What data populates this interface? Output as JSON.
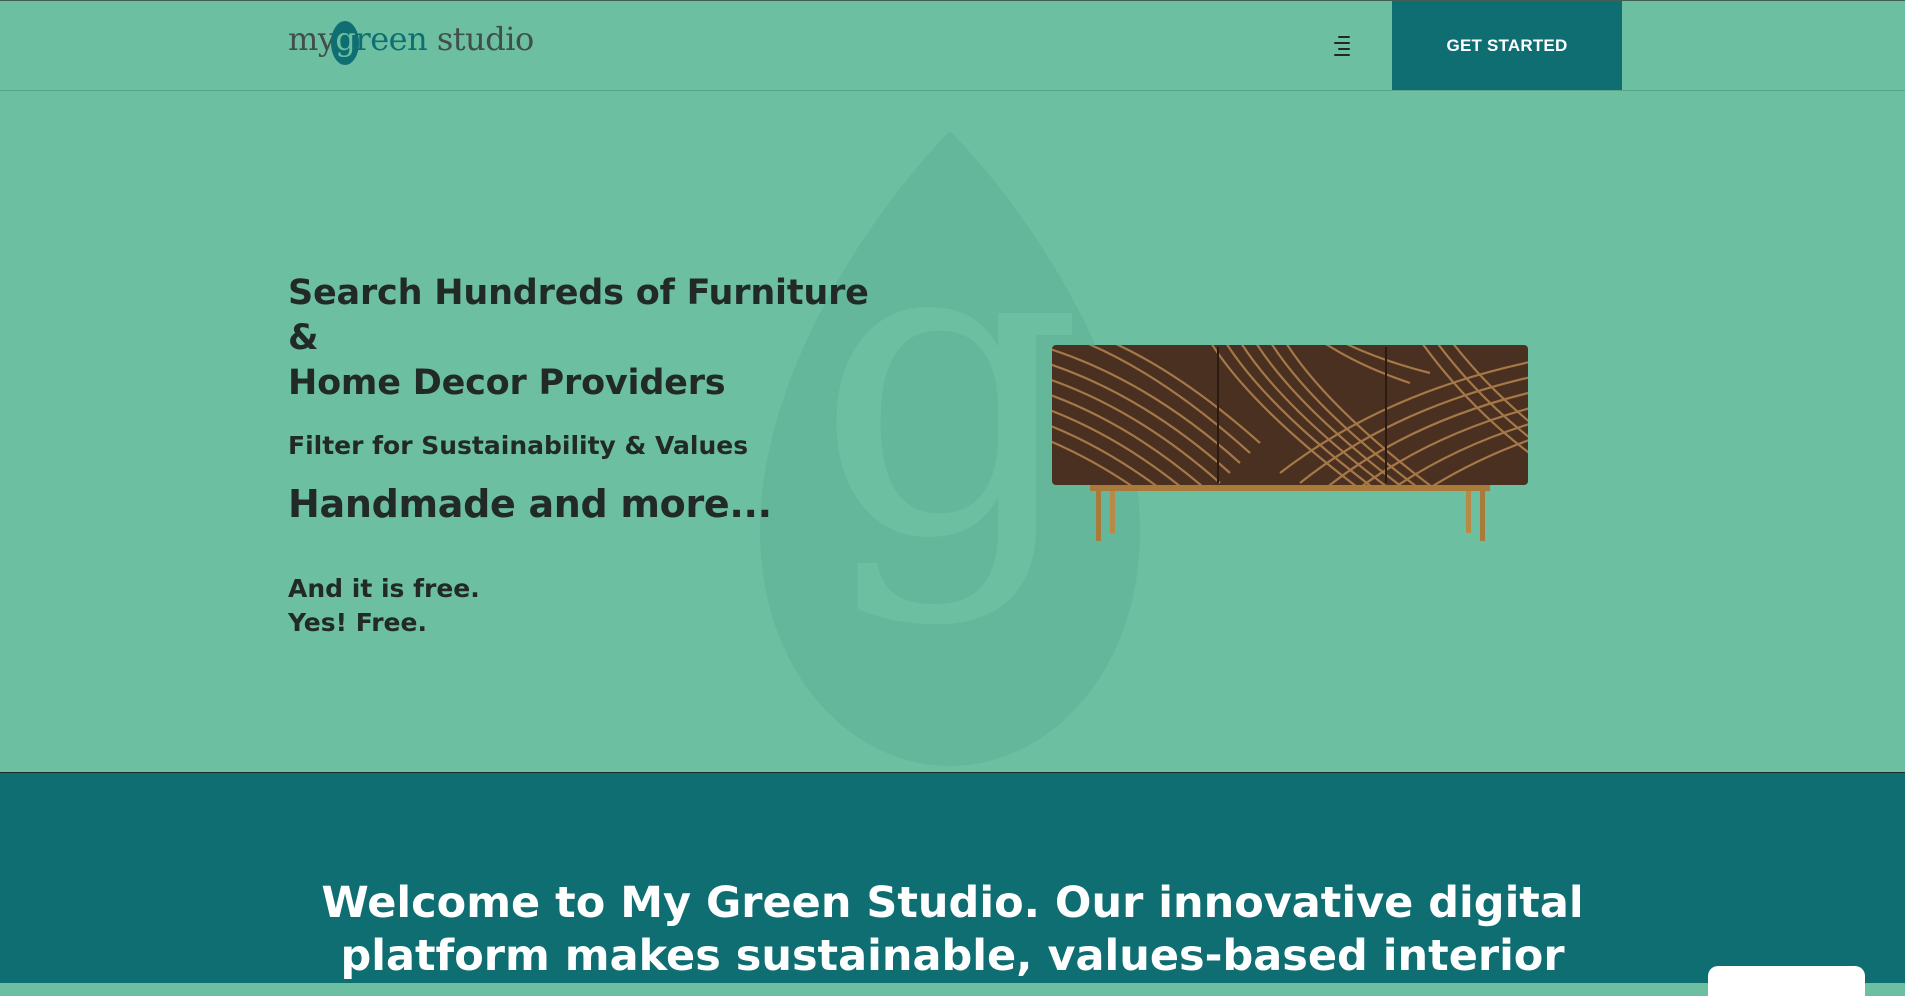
{
  "brand": {
    "logo_part1": "my",
    "logo_part2": "g",
    "logo_part3": "reen",
    "logo_part4": " studio",
    "colors": {
      "mint": "#6dbfa1",
      "teal": "#0f6e72",
      "text_dark": "#222a28",
      "white": "#ffffff"
    }
  },
  "header": {
    "menu_icon": "menu-icon",
    "cta_label": "GET STARTED"
  },
  "hero": {
    "heading_line1": "Search Hundreds of Furniture &",
    "heading_line2": "Home Decor Providers",
    "subheading": "Filter for Sustainability & Values",
    "tagline": "Handmade and more...",
    "free_line1": "And it is free.",
    "free_line2": "Yes! Free.",
    "watermark_icon": "drop-g-watermark-icon",
    "image_icon": "sideboard-image"
  },
  "welcome": {
    "line1": "Welcome to My Green Studio. Our innovative digital",
    "line2": "platform makes sustainable, values-based interior"
  },
  "chat": {
    "icon": "chat-widget-tab"
  }
}
